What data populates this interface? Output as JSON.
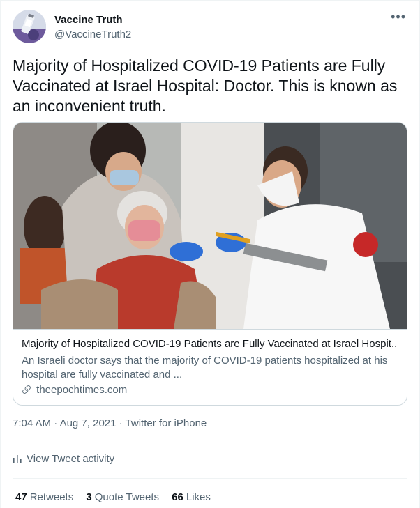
{
  "author": {
    "name": "Vaccine Truth",
    "handle": "@VaccineTruth2",
    "more_label": "•••"
  },
  "tweet": {
    "text": "Majority of Hospitalized COVID-19 Patients are Fully Vaccinated at Israel Hospital: Doctor.  This is known as an inconvenient truth."
  },
  "card": {
    "title": "Majority of Hospitalized COVID-19 Patients are Fully Vaccinated at Israel Hospit...",
    "description": "An Israeli doctor says that the majority of COVID-19 patients hospitalized at his hospital are fully vaccinated and ...",
    "domain": "theepochtimes.com",
    "image_icon": "vaccination-photo",
    "link_icon": "link-icon"
  },
  "meta": {
    "time": "7:04 AM",
    "date": "Aug 7, 2021",
    "source": "Twitter for iPhone"
  },
  "activity": {
    "label": "View Tweet activity",
    "icon": "bar-chart-icon"
  },
  "stats": {
    "retweets_count": "47",
    "retweets_label": "Retweets",
    "quotes_count": "3",
    "quotes_label": "Quote Tweets",
    "likes_count": "66",
    "likes_label": "Likes"
  },
  "colors": {
    "text_primary": "#0f1419",
    "text_secondary": "#536471",
    "border": "#cfd9de",
    "divider": "#eff3f4"
  }
}
